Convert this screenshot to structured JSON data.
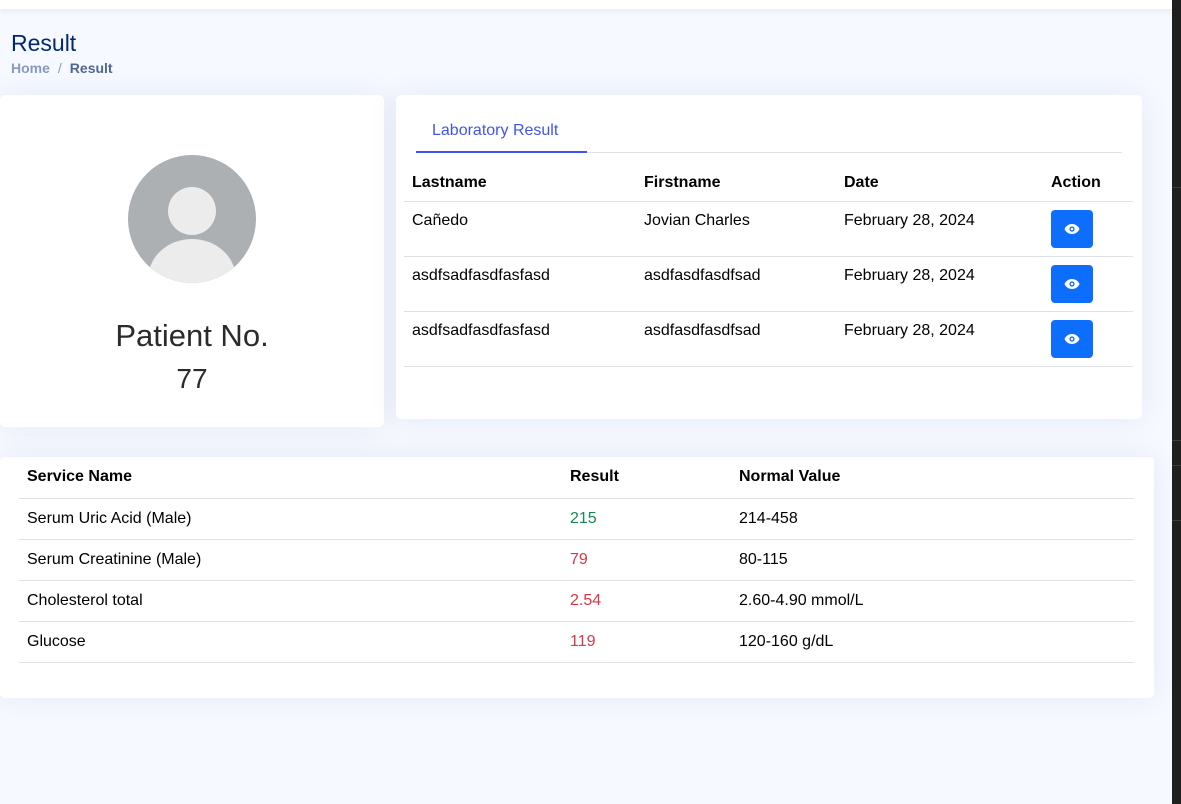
{
  "page": {
    "title": "Result"
  },
  "breadcrumb": {
    "home": "Home",
    "separator": "/",
    "current": "Result"
  },
  "patient": {
    "label": "Patient No.",
    "number": "77"
  },
  "lab": {
    "tab_label": "Laboratory Result",
    "columns": [
      "Lastname",
      "Firstname",
      "Date",
      "Action"
    ],
    "rows": [
      {
        "lastname": "Cañedo",
        "firstname": "Jovian Charles",
        "date": "February 28, 2024"
      },
      {
        "lastname": "asdfsadfasdfasfasd",
        "firstname": "asdfasdfasdfsad",
        "date": "February 28, 2024"
      },
      {
        "lastname": "asdfsadfasdfasfasd",
        "firstname": "asdfasdfasdfsad",
        "date": "February 28, 2024"
      }
    ],
    "action_icon": "eye-icon"
  },
  "results": {
    "columns": [
      "Service Name",
      "Result",
      "Normal Value"
    ],
    "rows": [
      {
        "service": "Serum Uric Acid (Male)",
        "result": "215",
        "normal": "214-458",
        "status": "normal"
      },
      {
        "service": "Serum Creatinine (Male)",
        "result": "79",
        "normal": "80-115",
        "status": "low"
      },
      {
        "service": "Cholesterol total",
        "result": "2.54",
        "normal": "2.60-4.90 mmol/L",
        "status": "low"
      },
      {
        "service": "Glucose",
        "result": "119",
        "normal": "120-160 g/dL",
        "status": "low"
      }
    ]
  },
  "colors": {
    "accent": "#4154f1",
    "button": "#0d6efd",
    "normal": "#198754",
    "abnormal": "#dc3545",
    "title": "#012970"
  }
}
